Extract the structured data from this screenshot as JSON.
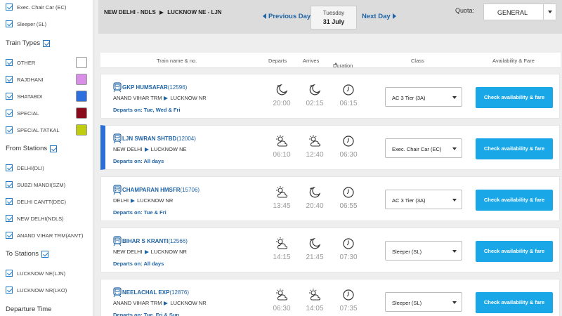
{
  "sidebar": {
    "class_filters": [
      {
        "label": "Exec. Chair Car (EC)",
        "checked": true
      },
      {
        "label": "Sleeper (SL)",
        "checked": true
      }
    ],
    "train_types_title": "Train Types",
    "train_types": [
      {
        "label": "OTHER",
        "color": "#ffffff"
      },
      {
        "label": "RAJDHANI",
        "color": "#d98ee8"
      },
      {
        "label": "SHATABDI",
        "color": "#2e6fe0"
      },
      {
        "label": "SPECIAL",
        "color": "#8a0c1c"
      },
      {
        "label": "SPECIAL TATKAL",
        "color": "#c0cc10"
      }
    ],
    "from_stations_title": "From Stations",
    "from_stations": [
      {
        "label": "DELHI(DLI)"
      },
      {
        "label": "SUBZI MANDI(SZM)"
      },
      {
        "label": "DELHI CANTT(DEC)"
      },
      {
        "label": "NEW DELHI(NDLS)"
      },
      {
        "label": "ANAND VIHAR TRM(ANVT)"
      }
    ],
    "to_stations_title": "To Stations",
    "to_stations": [
      {
        "label": "LUCKNOW NE(LJN)"
      },
      {
        "label": "LUCKNOW NR(LKO)"
      }
    ],
    "departure_time_title": "Departure Time"
  },
  "topbar": {
    "route_from": "NEW DELHI - NDLS",
    "route_to": "LUCKNOW NE - LJN",
    "prev_label": "Previous Day",
    "next_label": "Next Day",
    "date_weekday": "Tuesday",
    "date_day": "31 July",
    "quota_label": "Quota:",
    "quota_value": "GENERAL"
  },
  "table_head": {
    "train": "Train name & no.",
    "departs": "Departs",
    "arrives": "Arrives",
    "duration": "Duration",
    "class": "Class",
    "availability": "Availability & Fare"
  },
  "trains": [
    {
      "name": "GKP HUMSAFAR",
      "number": "(12596)",
      "from": "ANAND VIHAR TRM",
      "to": "LUCKNOW NR",
      "days": "Departs on: Tue, Wed & Fri",
      "departs": "20:00",
      "arrives": "02:15",
      "duration": "06:15",
      "class": "AC 3 Tier (3A)",
      "button": "Check availability & fare",
      "dep_icon": "moon-icon",
      "arr_icon": "moon-icon"
    },
    {
      "name": "LJN SWRAN SHTBD",
      "number": "(12004)",
      "from": "NEW DELHI",
      "to": "LUCKNOW NE",
      "days": "Departs on: All days",
      "departs": "06:10",
      "arrives": "12:40",
      "duration": "06:30",
      "class": "Exec. Chair Car (EC)",
      "button": "Check availability & fare",
      "dep_icon": "sun-cloud-icon",
      "arr_icon": "sun-cloud-icon"
    },
    {
      "name": "CHAMPARAN HMSFR",
      "number": "(15706)",
      "from": "DELHI",
      "to": "LUCKNOW NR",
      "days": "Departs on: Tue & Fri",
      "departs": "13:45",
      "arrives": "20:40",
      "duration": "06:55",
      "class": "AC 3 Tier (3A)",
      "button": "Check availability & fare",
      "dep_icon": "sun-cloud-icon",
      "arr_icon": "moon-icon"
    },
    {
      "name": "BIHAR S KRANTI",
      "number": "(12566)",
      "from": "NEW DELHI",
      "to": "LUCKNOW NR",
      "days": "Departs on: All days",
      "departs": "14:15",
      "arrives": "21:45",
      "duration": "07:30",
      "class": "Sleeper (SL)",
      "button": "Check availability & fare",
      "dep_icon": "sun-cloud-icon",
      "arr_icon": "moon-icon"
    },
    {
      "name": "NEELACHAL EXP",
      "number": "(12876)",
      "from": "ANAND VIHAR TRM",
      "to": "LUCKNOW NR",
      "days": "Departs on: Tue, Fri & Sun",
      "departs": "06:30",
      "arrives": "14:05",
      "duration": "07:35",
      "class": "Sleeper (SL)",
      "button": "Check availability & fare",
      "dep_icon": "sun-cloud-icon",
      "arr_icon": "sun-cloud-icon"
    }
  ],
  "colors": {
    "accent": "#1e63a5",
    "button": "#1aa7e8",
    "highlight": "#2b6fd6"
  }
}
